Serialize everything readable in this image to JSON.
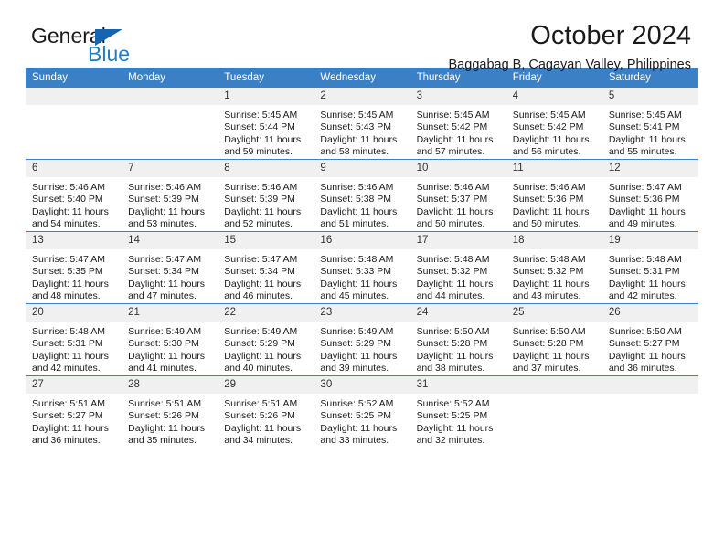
{
  "brand": {
    "name_top": "General",
    "name_bottom": "Blue",
    "triangle_color": "#1565b0",
    "blue_color": "#1f7ec4"
  },
  "header": {
    "title": "October 2024",
    "subtitle": "Baggabag B, Cagayan Valley, Philippines"
  },
  "theme": {
    "header_blue": "#3b7fc4",
    "daynum_gray": "#f0f0f0"
  },
  "calendar": {
    "weekdays": [
      "Sunday",
      "Monday",
      "Tuesday",
      "Wednesday",
      "Thursday",
      "Friday",
      "Saturday"
    ],
    "weeks": [
      [
        {
          "day": "",
          "sunrise": "",
          "sunset": "",
          "daylight1": "",
          "daylight2": "",
          "empty": true
        },
        {
          "day": "",
          "sunrise": "",
          "sunset": "",
          "daylight1": "",
          "daylight2": "",
          "empty": true
        },
        {
          "day": "1",
          "sunrise": "Sunrise: 5:45 AM",
          "sunset": "Sunset: 5:44 PM",
          "daylight1": "Daylight: 11 hours",
          "daylight2": "and 59 minutes."
        },
        {
          "day": "2",
          "sunrise": "Sunrise: 5:45 AM",
          "sunset": "Sunset: 5:43 PM",
          "daylight1": "Daylight: 11 hours",
          "daylight2": "and 58 minutes."
        },
        {
          "day": "3",
          "sunrise": "Sunrise: 5:45 AM",
          "sunset": "Sunset: 5:42 PM",
          "daylight1": "Daylight: 11 hours",
          "daylight2": "and 57 minutes."
        },
        {
          "day": "4",
          "sunrise": "Sunrise: 5:45 AM",
          "sunset": "Sunset: 5:42 PM",
          "daylight1": "Daylight: 11 hours",
          "daylight2": "and 56 minutes."
        },
        {
          "day": "5",
          "sunrise": "Sunrise: 5:45 AM",
          "sunset": "Sunset: 5:41 PM",
          "daylight1": "Daylight: 11 hours",
          "daylight2": "and 55 minutes."
        }
      ],
      [
        {
          "day": "6",
          "sunrise": "Sunrise: 5:46 AM",
          "sunset": "Sunset: 5:40 PM",
          "daylight1": "Daylight: 11 hours",
          "daylight2": "and 54 minutes."
        },
        {
          "day": "7",
          "sunrise": "Sunrise: 5:46 AM",
          "sunset": "Sunset: 5:39 PM",
          "daylight1": "Daylight: 11 hours",
          "daylight2": "and 53 minutes."
        },
        {
          "day": "8",
          "sunrise": "Sunrise: 5:46 AM",
          "sunset": "Sunset: 5:39 PM",
          "daylight1": "Daylight: 11 hours",
          "daylight2": "and 52 minutes."
        },
        {
          "day": "9",
          "sunrise": "Sunrise: 5:46 AM",
          "sunset": "Sunset: 5:38 PM",
          "daylight1": "Daylight: 11 hours",
          "daylight2": "and 51 minutes."
        },
        {
          "day": "10",
          "sunrise": "Sunrise: 5:46 AM",
          "sunset": "Sunset: 5:37 PM",
          "daylight1": "Daylight: 11 hours",
          "daylight2": "and 50 minutes."
        },
        {
          "day": "11",
          "sunrise": "Sunrise: 5:46 AM",
          "sunset": "Sunset: 5:36 PM",
          "daylight1": "Daylight: 11 hours",
          "daylight2": "and 50 minutes."
        },
        {
          "day": "12",
          "sunrise": "Sunrise: 5:47 AM",
          "sunset": "Sunset: 5:36 PM",
          "daylight1": "Daylight: 11 hours",
          "daylight2": "and 49 minutes."
        }
      ],
      [
        {
          "day": "13",
          "sunrise": "Sunrise: 5:47 AM",
          "sunset": "Sunset: 5:35 PM",
          "daylight1": "Daylight: 11 hours",
          "daylight2": "and 48 minutes."
        },
        {
          "day": "14",
          "sunrise": "Sunrise: 5:47 AM",
          "sunset": "Sunset: 5:34 PM",
          "daylight1": "Daylight: 11 hours",
          "daylight2": "and 47 minutes."
        },
        {
          "day": "15",
          "sunrise": "Sunrise: 5:47 AM",
          "sunset": "Sunset: 5:34 PM",
          "daylight1": "Daylight: 11 hours",
          "daylight2": "and 46 minutes."
        },
        {
          "day": "16",
          "sunrise": "Sunrise: 5:48 AM",
          "sunset": "Sunset: 5:33 PM",
          "daylight1": "Daylight: 11 hours",
          "daylight2": "and 45 minutes."
        },
        {
          "day": "17",
          "sunrise": "Sunrise: 5:48 AM",
          "sunset": "Sunset: 5:32 PM",
          "daylight1": "Daylight: 11 hours",
          "daylight2": "and 44 minutes."
        },
        {
          "day": "18",
          "sunrise": "Sunrise: 5:48 AM",
          "sunset": "Sunset: 5:32 PM",
          "daylight1": "Daylight: 11 hours",
          "daylight2": "and 43 minutes."
        },
        {
          "day": "19",
          "sunrise": "Sunrise: 5:48 AM",
          "sunset": "Sunset: 5:31 PM",
          "daylight1": "Daylight: 11 hours",
          "daylight2": "and 42 minutes."
        }
      ],
      [
        {
          "day": "20",
          "sunrise": "Sunrise: 5:48 AM",
          "sunset": "Sunset: 5:31 PM",
          "daylight1": "Daylight: 11 hours",
          "daylight2": "and 42 minutes."
        },
        {
          "day": "21",
          "sunrise": "Sunrise: 5:49 AM",
          "sunset": "Sunset: 5:30 PM",
          "daylight1": "Daylight: 11 hours",
          "daylight2": "and 41 minutes."
        },
        {
          "day": "22",
          "sunrise": "Sunrise: 5:49 AM",
          "sunset": "Sunset: 5:29 PM",
          "daylight1": "Daylight: 11 hours",
          "daylight2": "and 40 minutes."
        },
        {
          "day": "23",
          "sunrise": "Sunrise: 5:49 AM",
          "sunset": "Sunset: 5:29 PM",
          "daylight1": "Daylight: 11 hours",
          "daylight2": "and 39 minutes."
        },
        {
          "day": "24",
          "sunrise": "Sunrise: 5:50 AM",
          "sunset": "Sunset: 5:28 PM",
          "daylight1": "Daylight: 11 hours",
          "daylight2": "and 38 minutes."
        },
        {
          "day": "25",
          "sunrise": "Sunrise: 5:50 AM",
          "sunset": "Sunset: 5:28 PM",
          "daylight1": "Daylight: 11 hours",
          "daylight2": "and 37 minutes."
        },
        {
          "day": "26",
          "sunrise": "Sunrise: 5:50 AM",
          "sunset": "Sunset: 5:27 PM",
          "daylight1": "Daylight: 11 hours",
          "daylight2": "and 36 minutes."
        }
      ],
      [
        {
          "day": "27",
          "sunrise": "Sunrise: 5:51 AM",
          "sunset": "Sunset: 5:27 PM",
          "daylight1": "Daylight: 11 hours",
          "daylight2": "and 36 minutes."
        },
        {
          "day": "28",
          "sunrise": "Sunrise: 5:51 AM",
          "sunset": "Sunset: 5:26 PM",
          "daylight1": "Daylight: 11 hours",
          "daylight2": "and 35 minutes."
        },
        {
          "day": "29",
          "sunrise": "Sunrise: 5:51 AM",
          "sunset": "Sunset: 5:26 PM",
          "daylight1": "Daylight: 11 hours",
          "daylight2": "and 34 minutes."
        },
        {
          "day": "30",
          "sunrise": "Sunrise: 5:52 AM",
          "sunset": "Sunset: 5:25 PM",
          "daylight1": "Daylight: 11 hours",
          "daylight2": "and 33 minutes."
        },
        {
          "day": "31",
          "sunrise": "Sunrise: 5:52 AM",
          "sunset": "Sunset: 5:25 PM",
          "daylight1": "Daylight: 11 hours",
          "daylight2": "and 32 minutes."
        },
        {
          "day": "",
          "sunrise": "",
          "sunset": "",
          "daylight1": "",
          "daylight2": "",
          "empty": true
        },
        {
          "day": "",
          "sunrise": "",
          "sunset": "",
          "daylight1": "",
          "daylight2": "",
          "empty": true
        }
      ]
    ]
  }
}
